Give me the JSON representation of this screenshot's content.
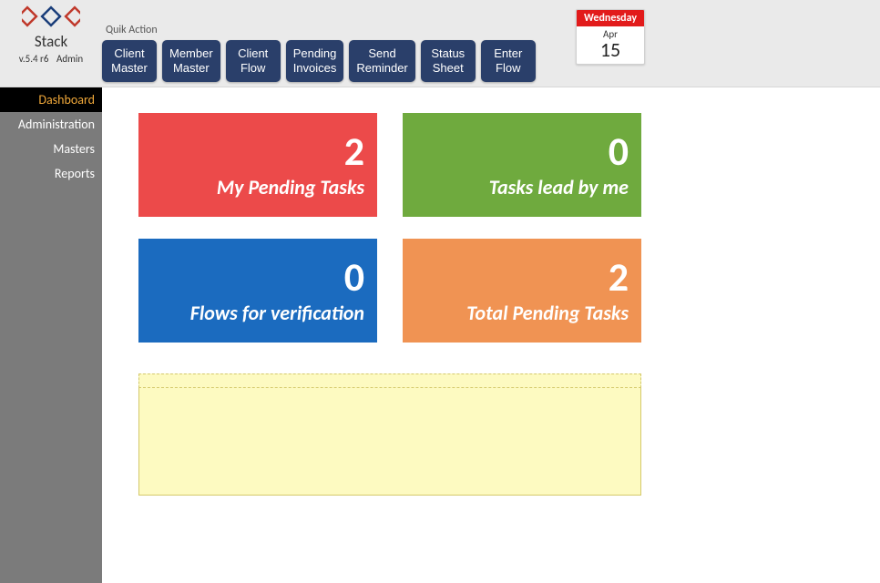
{
  "brand": {
    "name": "Stack",
    "version": "v.5.4 r6",
    "role": "Admin"
  },
  "quick_action_label": "Quik Action",
  "quick_actions": [
    "Client\nMaster",
    "Member\nMaster",
    "Client\nFlow",
    "Pending\nInvoices",
    "Send\nReminder",
    "Status\nSheet",
    "Enter\nFlow"
  ],
  "date": {
    "weekday": "Wednesday",
    "month": "Apr",
    "day": "15"
  },
  "sidebar": {
    "items": [
      {
        "label": "Dashboard",
        "active": true
      },
      {
        "label": "Administration",
        "active": false
      },
      {
        "label": "Masters",
        "active": false
      },
      {
        "label": "Reports",
        "active": false
      }
    ]
  },
  "tiles": [
    {
      "value": "2",
      "label": "My Pending Tasks",
      "class": "tile-a"
    },
    {
      "value": "0",
      "label": "Tasks lead by me",
      "class": "tile-b"
    },
    {
      "value": "0",
      "label": "Flows for verification",
      "class": "tile-c"
    },
    {
      "value": "2",
      "label": "Total Pending Tasks",
      "class": "tile-d"
    }
  ],
  "notes": ""
}
